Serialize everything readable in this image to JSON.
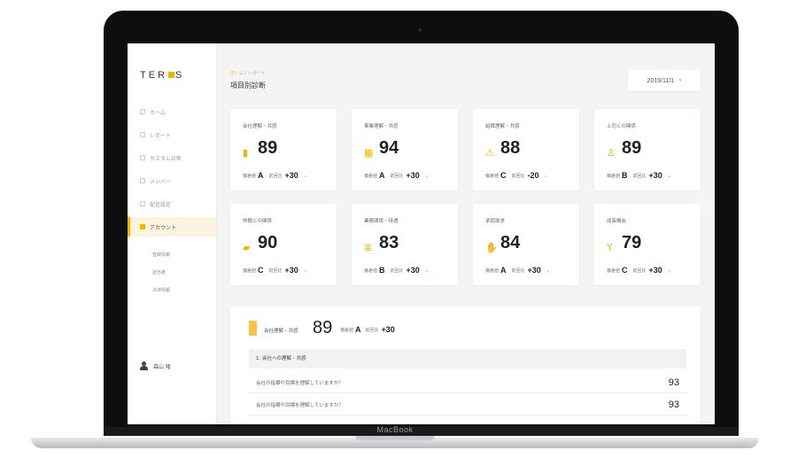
{
  "laptop": {
    "brand": "MacBook"
  },
  "app": {
    "logo_left": "TER",
    "logo_right": "S",
    "breadcrumb": {
      "home": "ホーム",
      "separator": "/",
      "current": "レポート"
    },
    "page_title": "項目別診断",
    "date_select": {
      "value": "2019/11/1",
      "chevron": "▾"
    }
  },
  "sidebar": {
    "items": [
      {
        "label": "ホーム"
      },
      {
        "label": "レポート"
      },
      {
        "label": "カスタム診断"
      },
      {
        "label": "メンバー"
      },
      {
        "label": "配信設定"
      },
      {
        "label": "アカウント"
      }
    ],
    "sub_items": [
      {
        "label": "登録情報"
      },
      {
        "label": "担当者"
      },
      {
        "label": "決済情報"
      }
    ],
    "user_name": "森山 隆"
  },
  "cards": [
    {
      "title": "会社理解・共感",
      "icon": "▮",
      "score": "89",
      "grade_label": "偏差値",
      "grade": "A",
      "diff_label": "前回比",
      "diff": "+30"
    },
    {
      "title": "事業理解・共感",
      "icon": "▦",
      "score": "94",
      "grade_label": "偏差値",
      "grade": "A",
      "diff_label": "前回比",
      "diff": "+30"
    },
    {
      "title": "組織理解・共感",
      "icon": "⚠",
      "score": "88",
      "grade_label": "偏差値",
      "grade": "C",
      "diff_label": "前回比",
      "diff": "-20"
    },
    {
      "title": "上司との関係",
      "icon": "♙",
      "score": "89",
      "grade_label": "偏差値",
      "grade": "B",
      "diff_label": "前回比",
      "diff": "+30"
    },
    {
      "title": "仲間との関係",
      "icon": "▰",
      "score": "90",
      "grade_label": "偏差値",
      "grade": "C",
      "diff_label": "前回比",
      "diff": "+30"
    },
    {
      "title": "業務環境・待遇",
      "icon": "≣",
      "score": "83",
      "grade_label": "偏差値",
      "grade": "B",
      "diff_label": "前回比",
      "diff": "+30"
    },
    {
      "title": "承認欲求",
      "icon": "✋",
      "score": "84",
      "grade_label": "偏差値",
      "grade": "A",
      "diff_label": "前回比",
      "diff": "+30"
    },
    {
      "title": "成長機会",
      "icon": "Y",
      "score": "79",
      "grade_label": "偏差値",
      "grade": "C",
      "diff_label": "前回比",
      "diff": "+30"
    }
  ],
  "detail": {
    "title": "会社理解・共感",
    "score": "89",
    "grade_label": "偏差値",
    "grade": "A",
    "diff_label": "前回比",
    "diff": "+30",
    "section": "1. 会社への理解・共感",
    "questions": [
      {
        "text": "会社の指標や目標を理解していますか？",
        "score": "93"
      },
      {
        "text": "会社の指標や目標を理解していますか？",
        "score": "93"
      }
    ]
  },
  "colors": {
    "accent": "#f2b400",
    "background": "#f4f4f4",
    "card": "#ffffff"
  },
  "icons": {
    "card_chevron": "⌄"
  }
}
